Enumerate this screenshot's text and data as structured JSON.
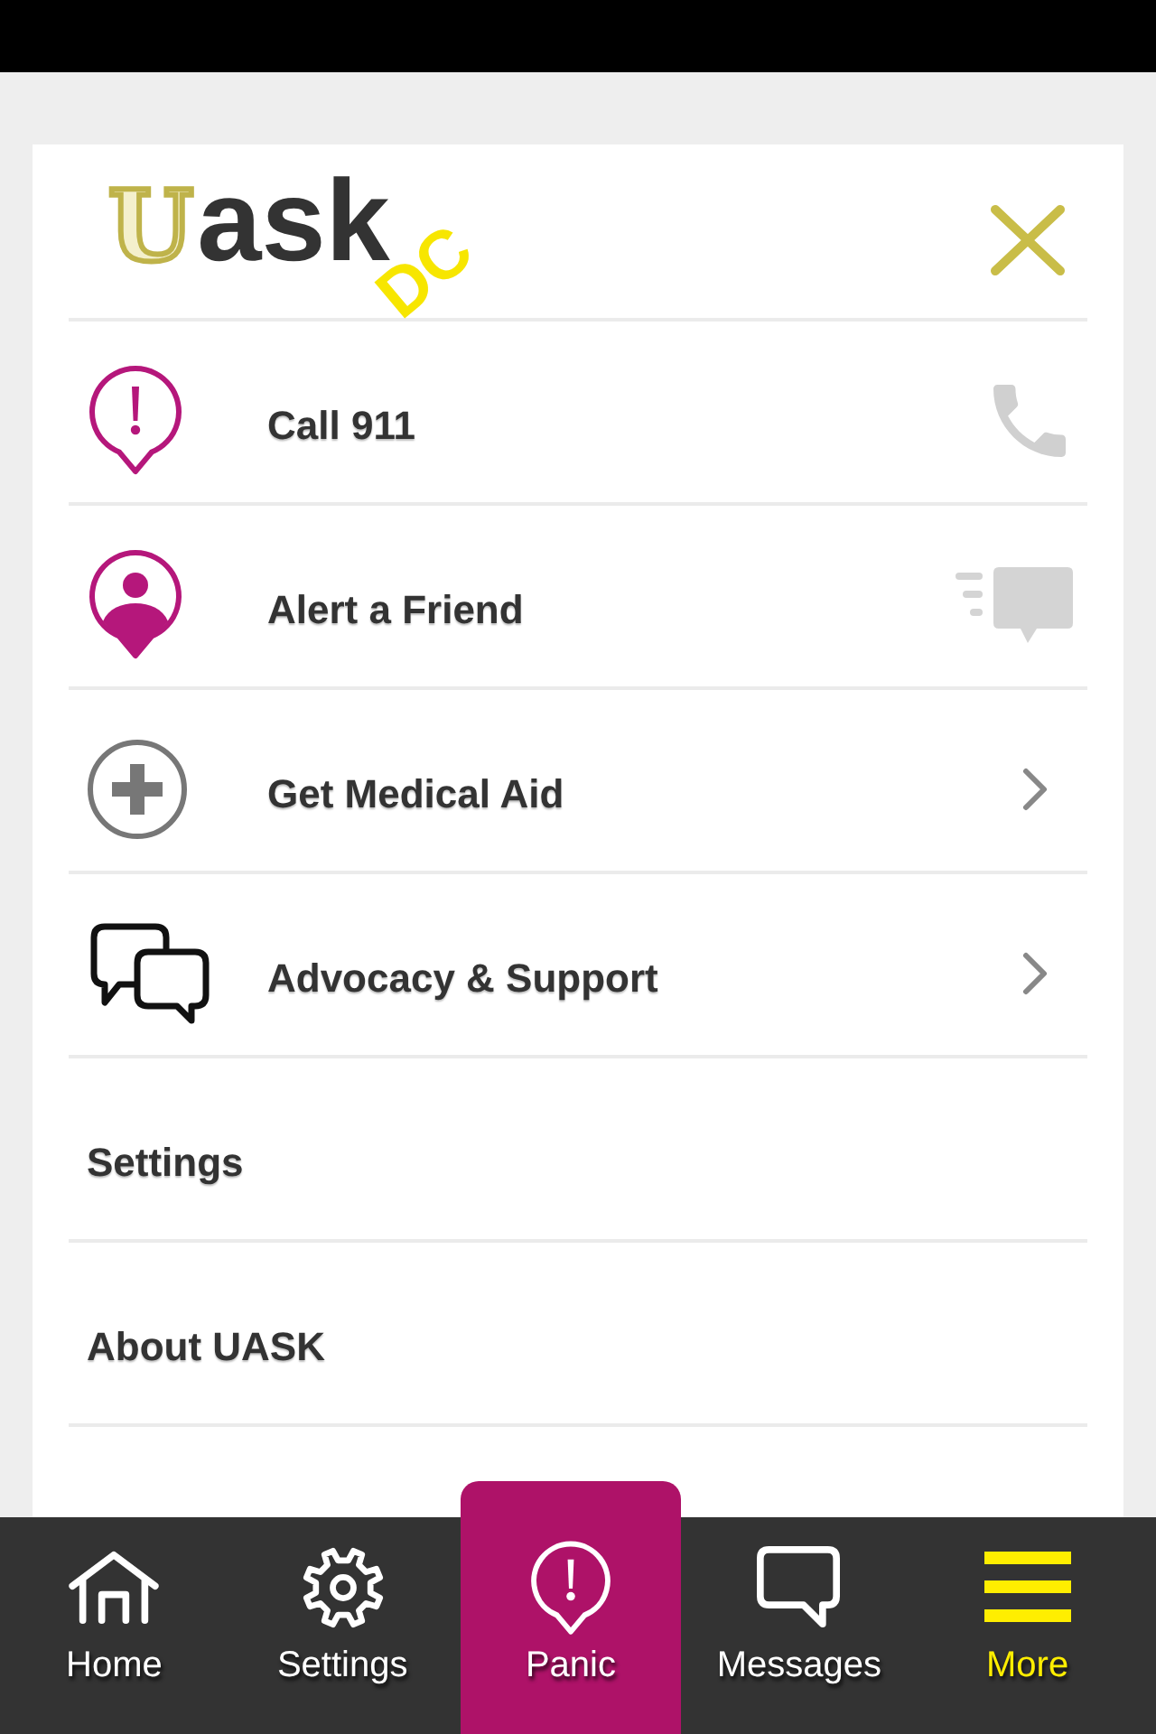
{
  "menu": {
    "logo": {
      "initial": "U",
      "rest": "ask",
      "tag": "DC"
    },
    "items": [
      {
        "kind": "action",
        "label": "Call 911"
      },
      {
        "kind": "action",
        "label": "Alert a Friend"
      },
      {
        "kind": "submenu",
        "label": "Get Medical Aid"
      },
      {
        "kind": "submenu",
        "label": "Advocacy & Support"
      },
      {
        "kind": "link",
        "label": "Settings"
      },
      {
        "kind": "link",
        "label": "About UASK"
      }
    ]
  },
  "tab_bar": [
    {
      "kind": "normal",
      "label": "Home",
      "selected": false
    },
    {
      "kind": "normal",
      "label": "Settings",
      "selected": false
    },
    {
      "kind": "emergency",
      "label": "Panic",
      "selected": false
    },
    {
      "kind": "normal",
      "label": "Messages",
      "selected": false
    },
    {
      "kind": "normal",
      "label": "More",
      "selected": true
    }
  ]
}
